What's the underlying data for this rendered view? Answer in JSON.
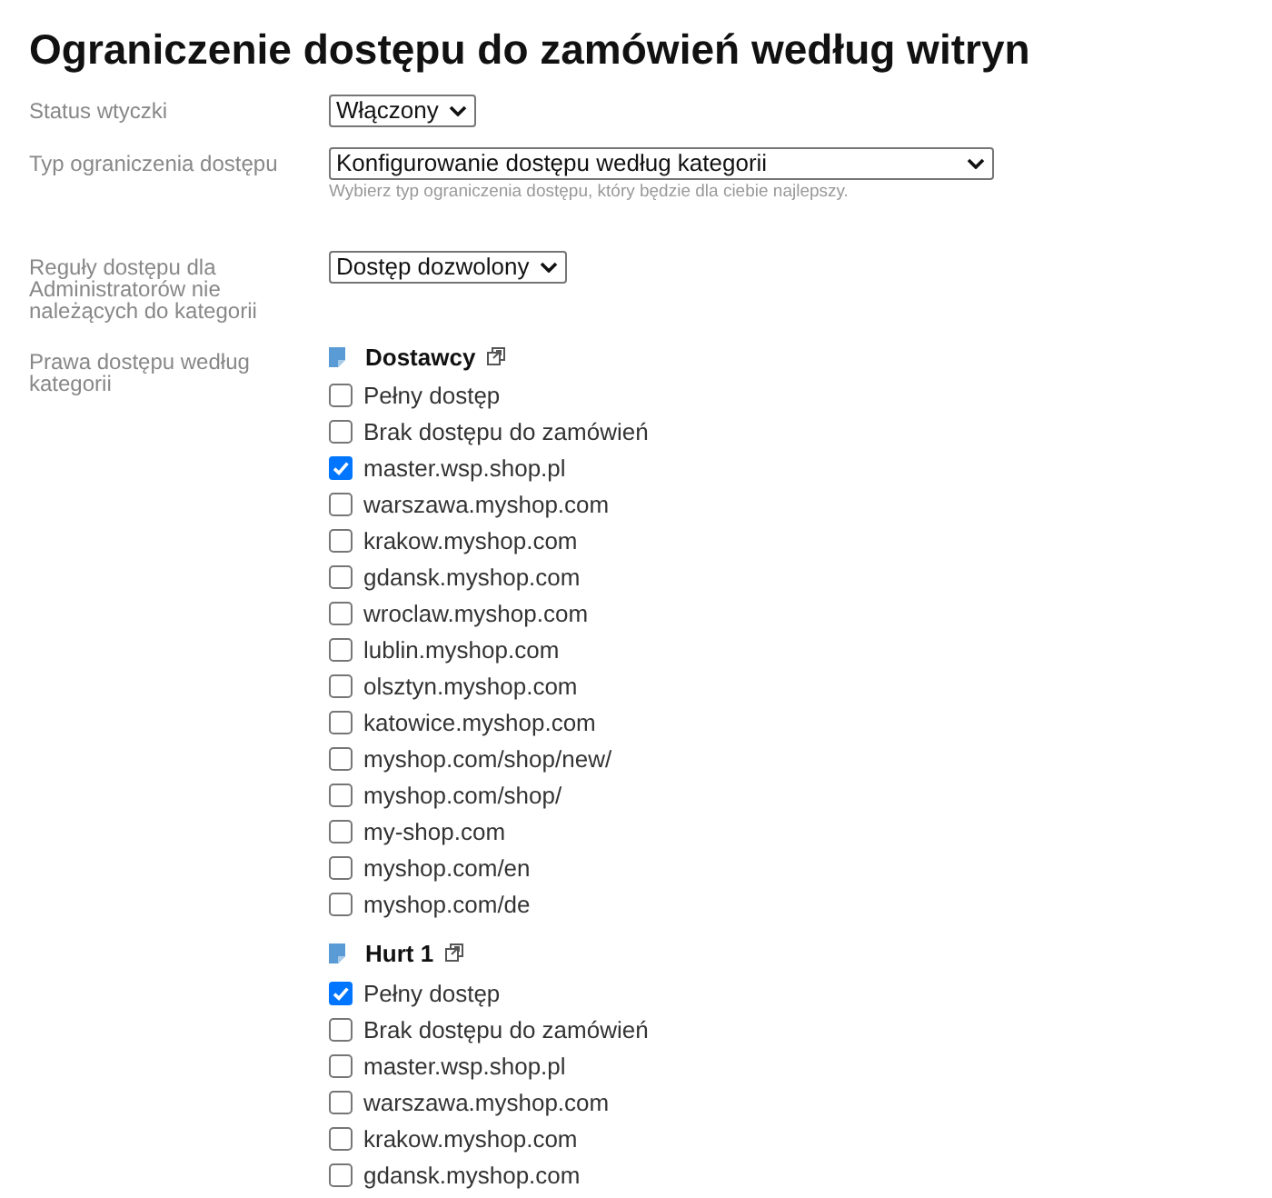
{
  "title": "Ograniczenie dostępu do zamówień według witryn",
  "settings": [
    {
      "kind": "select",
      "label": "Status wtyczki",
      "value": "Włączony"
    },
    {
      "kind": "select_wide",
      "label": "Typ ograniczenia dostępu",
      "value": "Konfigurowanie dostępu według kategorii",
      "hint": "Wybierz typ ograniczenia dostępu, który będzie dla ciebie najlepszy."
    },
    {
      "kind": "select",
      "label": "Reguły dostępu dla Administratorów nie należących do kategorii",
      "value": "Dostęp dozwolony"
    },
    {
      "kind": "categories",
      "label": "Prawa dostępu według kategorii",
      "categories": [
        {
          "name": "Dostawcy",
          "options": [
            {
              "label": "Pełny dostęp",
              "checked": false
            },
            {
              "label": "Brak dostępu do zamówień",
              "checked": false
            },
            {
              "label": "master.wsp.shop.pl",
              "checked": true
            },
            {
              "label": "warszawa.myshop.com",
              "checked": false
            },
            {
              "label": "krakow.myshop.com",
              "checked": false
            },
            {
              "label": "gdansk.myshop.com",
              "checked": false
            },
            {
              "label": "wroclaw.myshop.com",
              "checked": false
            },
            {
              "label": "lublin.myshop.com",
              "checked": false
            },
            {
              "label": "olsztyn.myshop.com",
              "checked": false
            },
            {
              "label": "katowice.myshop.com",
              "checked": false
            },
            {
              "label": "myshop.com/shop/new/",
              "checked": false
            },
            {
              "label": "myshop.com/shop/",
              "checked": false
            },
            {
              "label": "my-shop.com",
              "checked": false
            },
            {
              "label": "myshop.com/en",
              "checked": false
            },
            {
              "label": "myshop.com/de",
              "checked": false
            }
          ]
        },
        {
          "name": "Hurt 1",
          "options": [
            {
              "label": "Pełny dostęp",
              "checked": true
            },
            {
              "label": "Brak dostępu do zamówień",
              "checked": false
            },
            {
              "label": "master.wsp.shop.pl",
              "checked": false
            },
            {
              "label": "warszawa.myshop.com",
              "checked": false
            },
            {
              "label": "krakow.myshop.com",
              "checked": false
            },
            {
              "label": "gdansk.myshop.com",
              "checked": false
            }
          ]
        }
      ]
    }
  ]
}
